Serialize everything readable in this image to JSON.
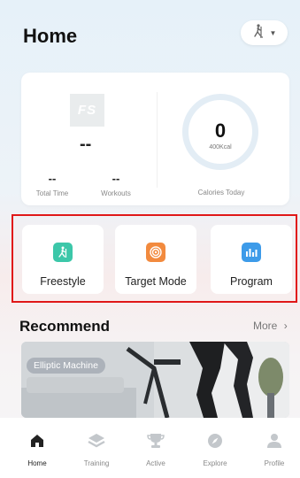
{
  "header": {
    "title": "Home"
  },
  "stats": {
    "logo_text": "FS",
    "distance_value": "--",
    "total_time_value": "--",
    "total_time_label": "Total Time",
    "workouts_value": "--",
    "workouts_label": "Workouts",
    "calories_value": "0",
    "calories_goal": "400Kcal",
    "calories_label": "Calories Today"
  },
  "modes": [
    {
      "label": "Freestyle",
      "color": "#3cc7a9"
    },
    {
      "label": "Target Mode",
      "color": "#f28a3e"
    },
    {
      "label": "Program",
      "color": "#3d9be9"
    }
  ],
  "recommend": {
    "title": "Recommend",
    "more_label": "More",
    "card_label": "Elliptic Machine"
  },
  "nav": [
    {
      "label": "Home",
      "icon": "home-icon",
      "active": true
    },
    {
      "label": "Training",
      "icon": "layers-icon",
      "active": false
    },
    {
      "label": "Active",
      "icon": "trophy-icon",
      "active": false
    },
    {
      "label": "Explore",
      "icon": "compass-icon",
      "active": false
    },
    {
      "label": "Profile",
      "icon": "person-icon",
      "active": false
    }
  ],
  "colors": {
    "highlight_border": "#e01818",
    "active_nav": "#222222",
    "inactive_nav": "#bfc3c7"
  }
}
